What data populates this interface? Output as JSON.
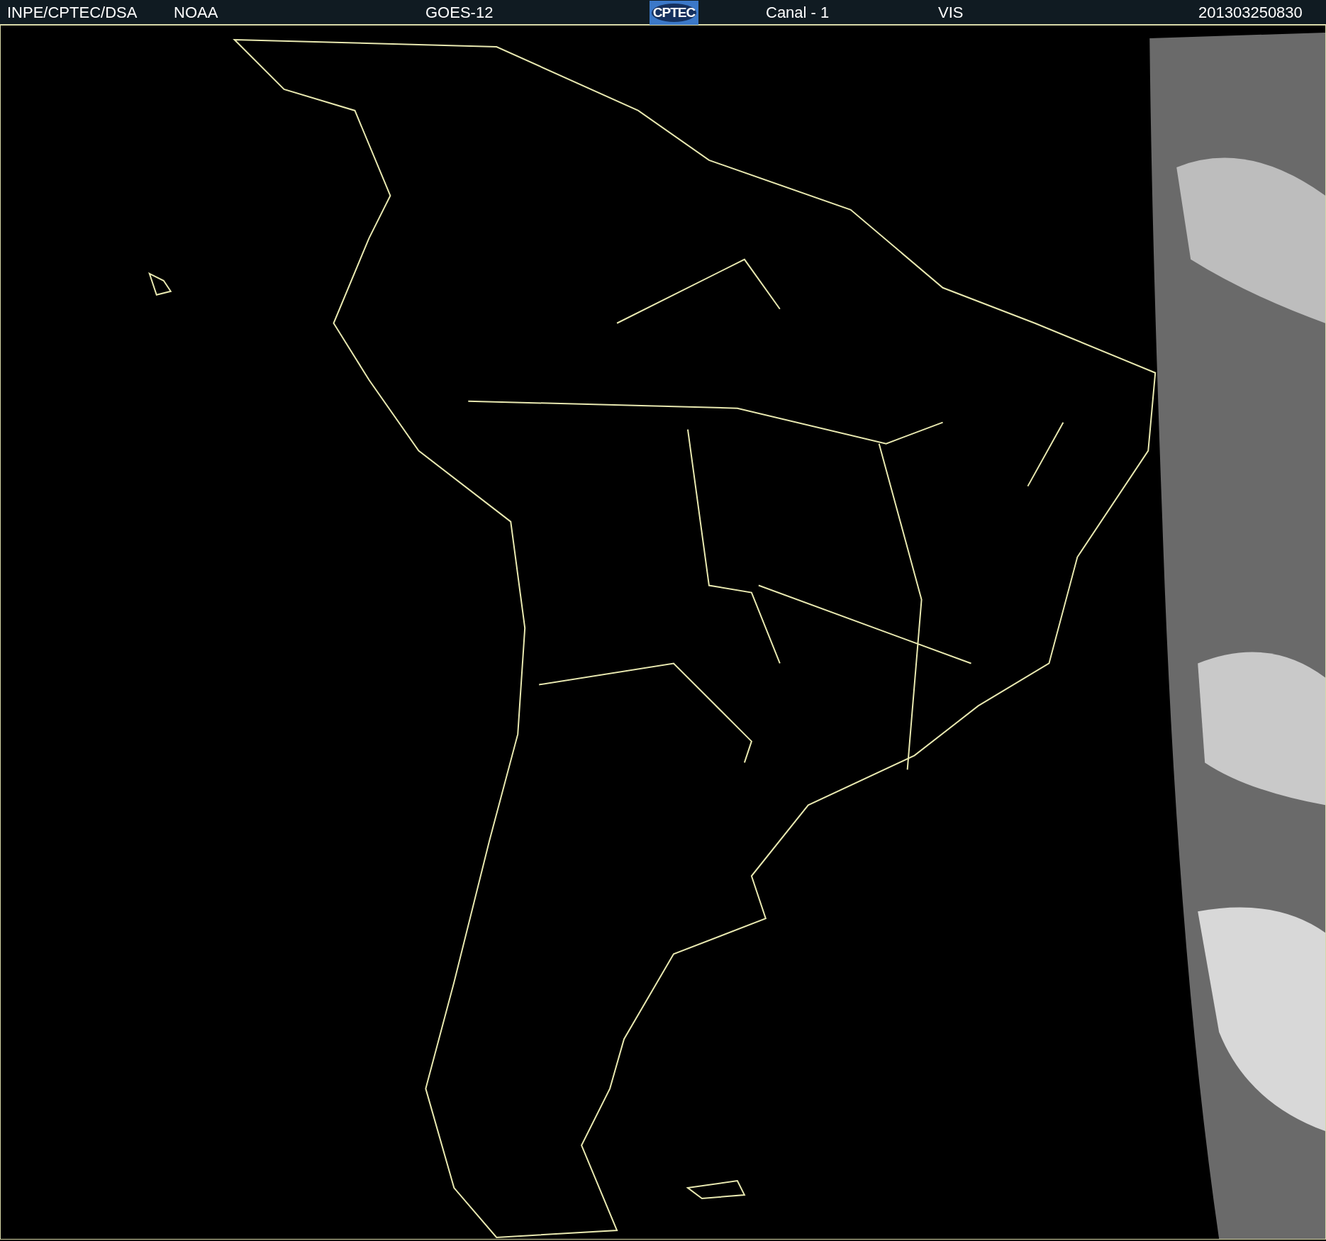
{
  "header": {
    "items": [
      {
        "kind": "text",
        "text": "INPE/CPTEC/DSA"
      },
      {
        "kind": "text",
        "text": "NOAA"
      },
      {
        "kind": "text",
        "text": "GOES-12"
      },
      {
        "kind": "logo",
        "text": "CPTEC"
      },
      {
        "kind": "text",
        "text": "Canal - 1"
      },
      {
        "kind": "text",
        "text": "VIS"
      },
      {
        "kind": "text",
        "text": "201303250830"
      }
    ]
  }
}
